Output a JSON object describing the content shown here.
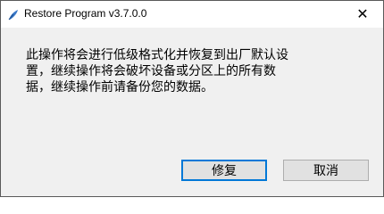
{
  "window": {
    "title": "Restore Program v3.7.0.0",
    "close_glyph": "✕"
  },
  "message": {
    "lines": [
      "此操作将会进行低级格式化并恢复到出厂默认设",
      "置，继续操作将会破坏设备或分区上的所有数",
      "据，继续操作前请备份您的数据。"
    ]
  },
  "buttons": {
    "repair_label": "修复",
    "cancel_label": "取消"
  },
  "colors": {
    "default_button_border": "#0078d7",
    "window_background": "#f0f0f0"
  },
  "icons": {
    "app": "app-feather-icon",
    "close": "close-icon"
  }
}
